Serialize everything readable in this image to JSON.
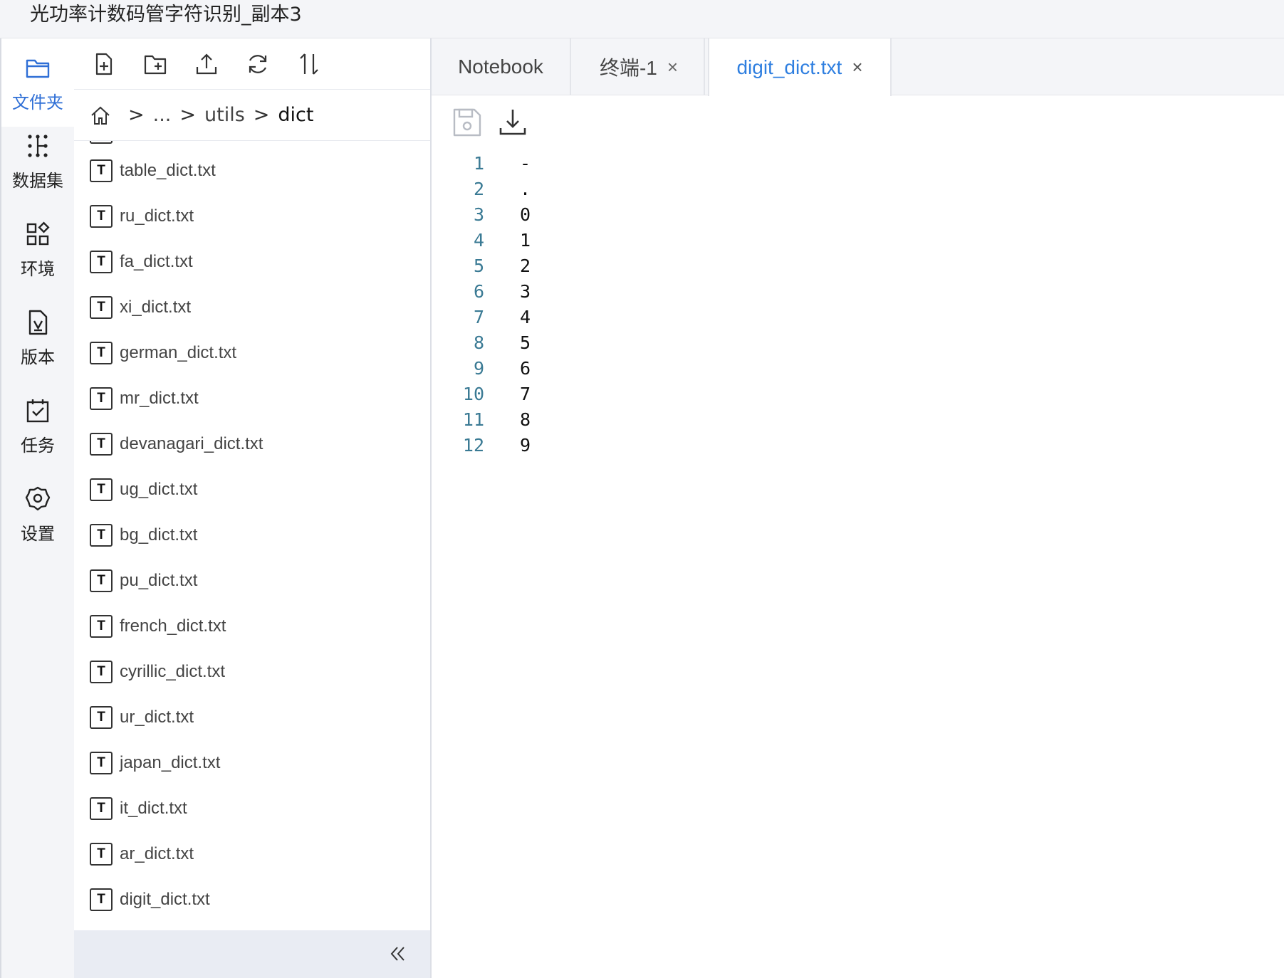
{
  "window": {
    "title": "光功率计数码管字符识别_副本3"
  },
  "rail": {
    "items": [
      {
        "label": "文件夹",
        "icon": "folder-icon",
        "active": true
      },
      {
        "label": "数据集",
        "icon": "dataset-icon",
        "active": false
      },
      {
        "label": "环境",
        "icon": "environment-icon",
        "active": false
      },
      {
        "label": "版本",
        "icon": "version-icon",
        "active": false
      },
      {
        "label": "任务",
        "icon": "task-icon",
        "active": false
      },
      {
        "label": "设置",
        "icon": "settings-icon",
        "active": false
      }
    ]
  },
  "explorer": {
    "toolbar": [
      "new-file-icon",
      "new-folder-icon",
      "upload-icon",
      "refresh-icon",
      "sort-icon"
    ],
    "breadcrumb": {
      "home_icon": "home-icon",
      "separator": ">",
      "items": [
        "...",
        "utils",
        "dict"
      ]
    },
    "files": [
      "table_dict.txt",
      "ru_dict.txt",
      "fa_dict.txt",
      "xi_dict.txt",
      "german_dict.txt",
      "mr_dict.txt",
      "devanagari_dict.txt",
      "ug_dict.txt",
      "bg_dict.txt",
      "pu_dict.txt",
      "french_dict.txt",
      "cyrillic_dict.txt",
      "ur_dict.txt",
      "japan_dict.txt",
      "it_dict.txt",
      "ar_dict.txt",
      "digit_dict.txt"
    ],
    "file_icon_letter": "T",
    "collapse_icon": "double-chevron-left-icon"
  },
  "editor": {
    "tabs": [
      {
        "label": "Notebook",
        "closable": false,
        "active": false
      },
      {
        "label": "终端-1",
        "closable": true,
        "active": false
      },
      {
        "label": "digit_dict.txt",
        "closable": true,
        "active": true
      }
    ],
    "close_glyph": "×",
    "toolbar": [
      "save-icon",
      "download-icon"
    ],
    "lines": [
      {
        "n": "1",
        "text": "-"
      },
      {
        "n": "2",
        "text": "."
      },
      {
        "n": "3",
        "text": "0"
      },
      {
        "n": "4",
        "text": "1"
      },
      {
        "n": "5",
        "text": "2"
      },
      {
        "n": "6",
        "text": "3"
      },
      {
        "n": "7",
        "text": "4"
      },
      {
        "n": "8",
        "text": "5"
      },
      {
        "n": "9",
        "text": "6"
      },
      {
        "n": "10",
        "text": "7"
      },
      {
        "n": "11",
        "text": "8"
      },
      {
        "n": "12",
        "text": "9"
      }
    ]
  },
  "colors": {
    "accent": "#2f7fe0",
    "line_number": "#3a7a94",
    "panel_bg": "#f4f5f8"
  }
}
